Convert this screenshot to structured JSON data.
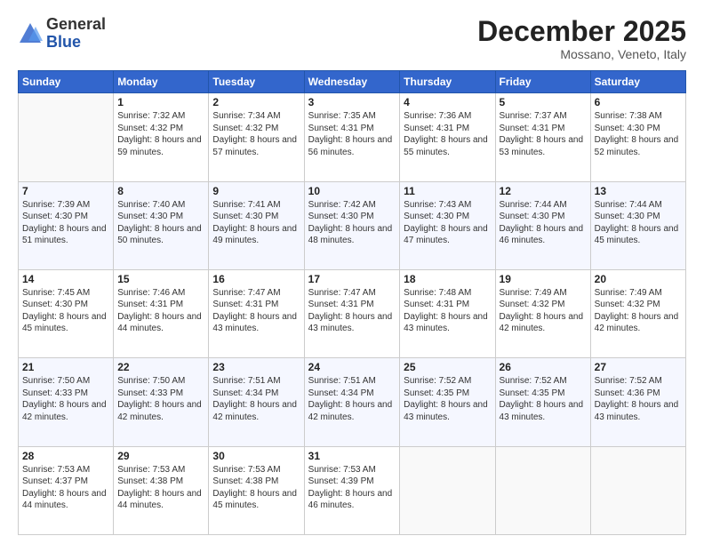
{
  "header": {
    "logo_general": "General",
    "logo_blue": "Blue",
    "month_title": "December 2025",
    "location": "Mossano, Veneto, Italy"
  },
  "calendar": {
    "weekdays": [
      "Sunday",
      "Monday",
      "Tuesday",
      "Wednesday",
      "Thursday",
      "Friday",
      "Saturday"
    ],
    "weeks": [
      [
        {
          "day": "",
          "sunrise": "",
          "sunset": "",
          "daylight": ""
        },
        {
          "day": "1",
          "sunrise": "Sunrise: 7:32 AM",
          "sunset": "Sunset: 4:32 PM",
          "daylight": "Daylight: 8 hours and 59 minutes."
        },
        {
          "day": "2",
          "sunrise": "Sunrise: 7:34 AM",
          "sunset": "Sunset: 4:32 PM",
          "daylight": "Daylight: 8 hours and 57 minutes."
        },
        {
          "day": "3",
          "sunrise": "Sunrise: 7:35 AM",
          "sunset": "Sunset: 4:31 PM",
          "daylight": "Daylight: 8 hours and 56 minutes."
        },
        {
          "day": "4",
          "sunrise": "Sunrise: 7:36 AM",
          "sunset": "Sunset: 4:31 PM",
          "daylight": "Daylight: 8 hours and 55 minutes."
        },
        {
          "day": "5",
          "sunrise": "Sunrise: 7:37 AM",
          "sunset": "Sunset: 4:31 PM",
          "daylight": "Daylight: 8 hours and 53 minutes."
        },
        {
          "day": "6",
          "sunrise": "Sunrise: 7:38 AM",
          "sunset": "Sunset: 4:30 PM",
          "daylight": "Daylight: 8 hours and 52 minutes."
        }
      ],
      [
        {
          "day": "7",
          "sunrise": "Sunrise: 7:39 AM",
          "sunset": "Sunset: 4:30 PM",
          "daylight": "Daylight: 8 hours and 51 minutes."
        },
        {
          "day": "8",
          "sunrise": "Sunrise: 7:40 AM",
          "sunset": "Sunset: 4:30 PM",
          "daylight": "Daylight: 8 hours and 50 minutes."
        },
        {
          "day": "9",
          "sunrise": "Sunrise: 7:41 AM",
          "sunset": "Sunset: 4:30 PM",
          "daylight": "Daylight: 8 hours and 49 minutes."
        },
        {
          "day": "10",
          "sunrise": "Sunrise: 7:42 AM",
          "sunset": "Sunset: 4:30 PM",
          "daylight": "Daylight: 8 hours and 48 minutes."
        },
        {
          "day": "11",
          "sunrise": "Sunrise: 7:43 AM",
          "sunset": "Sunset: 4:30 PM",
          "daylight": "Daylight: 8 hours and 47 minutes."
        },
        {
          "day": "12",
          "sunrise": "Sunrise: 7:44 AM",
          "sunset": "Sunset: 4:30 PM",
          "daylight": "Daylight: 8 hours and 46 minutes."
        },
        {
          "day": "13",
          "sunrise": "Sunrise: 7:44 AM",
          "sunset": "Sunset: 4:30 PM",
          "daylight": "Daylight: 8 hours and 45 minutes."
        }
      ],
      [
        {
          "day": "14",
          "sunrise": "Sunrise: 7:45 AM",
          "sunset": "Sunset: 4:30 PM",
          "daylight": "Daylight: 8 hours and 45 minutes."
        },
        {
          "day": "15",
          "sunrise": "Sunrise: 7:46 AM",
          "sunset": "Sunset: 4:31 PM",
          "daylight": "Daylight: 8 hours and 44 minutes."
        },
        {
          "day": "16",
          "sunrise": "Sunrise: 7:47 AM",
          "sunset": "Sunset: 4:31 PM",
          "daylight": "Daylight: 8 hours and 43 minutes."
        },
        {
          "day": "17",
          "sunrise": "Sunrise: 7:47 AM",
          "sunset": "Sunset: 4:31 PM",
          "daylight": "Daylight: 8 hours and 43 minutes."
        },
        {
          "day": "18",
          "sunrise": "Sunrise: 7:48 AM",
          "sunset": "Sunset: 4:31 PM",
          "daylight": "Daylight: 8 hours and 43 minutes."
        },
        {
          "day": "19",
          "sunrise": "Sunrise: 7:49 AM",
          "sunset": "Sunset: 4:32 PM",
          "daylight": "Daylight: 8 hours and 42 minutes."
        },
        {
          "day": "20",
          "sunrise": "Sunrise: 7:49 AM",
          "sunset": "Sunset: 4:32 PM",
          "daylight": "Daylight: 8 hours and 42 minutes."
        }
      ],
      [
        {
          "day": "21",
          "sunrise": "Sunrise: 7:50 AM",
          "sunset": "Sunset: 4:33 PM",
          "daylight": "Daylight: 8 hours and 42 minutes."
        },
        {
          "day": "22",
          "sunrise": "Sunrise: 7:50 AM",
          "sunset": "Sunset: 4:33 PM",
          "daylight": "Daylight: 8 hours and 42 minutes."
        },
        {
          "day": "23",
          "sunrise": "Sunrise: 7:51 AM",
          "sunset": "Sunset: 4:34 PM",
          "daylight": "Daylight: 8 hours and 42 minutes."
        },
        {
          "day": "24",
          "sunrise": "Sunrise: 7:51 AM",
          "sunset": "Sunset: 4:34 PM",
          "daylight": "Daylight: 8 hours and 42 minutes."
        },
        {
          "day": "25",
          "sunrise": "Sunrise: 7:52 AM",
          "sunset": "Sunset: 4:35 PM",
          "daylight": "Daylight: 8 hours and 43 minutes."
        },
        {
          "day": "26",
          "sunrise": "Sunrise: 7:52 AM",
          "sunset": "Sunset: 4:35 PM",
          "daylight": "Daylight: 8 hours and 43 minutes."
        },
        {
          "day": "27",
          "sunrise": "Sunrise: 7:52 AM",
          "sunset": "Sunset: 4:36 PM",
          "daylight": "Daylight: 8 hours and 43 minutes."
        }
      ],
      [
        {
          "day": "28",
          "sunrise": "Sunrise: 7:53 AM",
          "sunset": "Sunset: 4:37 PM",
          "daylight": "Daylight: 8 hours and 44 minutes."
        },
        {
          "day": "29",
          "sunrise": "Sunrise: 7:53 AM",
          "sunset": "Sunset: 4:38 PM",
          "daylight": "Daylight: 8 hours and 44 minutes."
        },
        {
          "day": "30",
          "sunrise": "Sunrise: 7:53 AM",
          "sunset": "Sunset: 4:38 PM",
          "daylight": "Daylight: 8 hours and 45 minutes."
        },
        {
          "day": "31",
          "sunrise": "Sunrise: 7:53 AM",
          "sunset": "Sunset: 4:39 PM",
          "daylight": "Daylight: 8 hours and 46 minutes."
        },
        {
          "day": "",
          "sunrise": "",
          "sunset": "",
          "daylight": ""
        },
        {
          "day": "",
          "sunrise": "",
          "sunset": "",
          "daylight": ""
        },
        {
          "day": "",
          "sunrise": "",
          "sunset": "",
          "daylight": ""
        }
      ]
    ]
  }
}
